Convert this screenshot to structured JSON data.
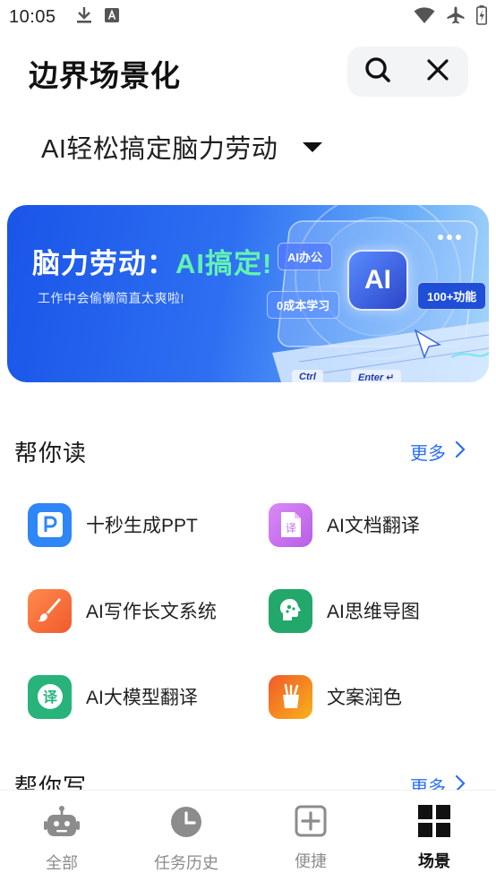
{
  "status_bar": {
    "time": "10:05",
    "left_icons": [
      "download-icon",
      "keyboard-a-icon"
    ],
    "right_icons": [
      "wifi-icon",
      "airplane-icon",
      "battery-charging-icon"
    ]
  },
  "header": {
    "title": "边界场景化",
    "actions": [
      "search-icon",
      "close-icon"
    ]
  },
  "selector": {
    "label": "AI轻松搞定脑力劳动"
  },
  "banner": {
    "headline_prefix": "脑力劳动：",
    "headline_accent": "AI搞定!",
    "subtitle": "工作中会偷懒简直太爽啦!",
    "tags": [
      "AI办公",
      "0成本学习",
      "100+功能"
    ],
    "logo_text": "AI",
    "keys": [
      "Ctrl",
      "Enter ↵"
    ],
    "colors": {
      "accent": "#62f2b2",
      "primary": "#2e6ff2"
    }
  },
  "sections": [
    {
      "title": "帮你读",
      "more": "更多",
      "items": [
        {
          "label": "十秒生成PPT",
          "icon": "ppt-icon",
          "color": "#2f86f6"
        },
        {
          "label": "AI文档翻译",
          "icon": "doc-translate-icon",
          "color": "#cf6ff0"
        },
        {
          "label": "AI写作长文系统",
          "icon": "brush-icon",
          "color": "#f46f3f"
        },
        {
          "label": "AI思维导图",
          "icon": "mind-map-icon",
          "color": "#22a86a"
        },
        {
          "label": "AI大模型翻译",
          "icon": "translate-icon",
          "color": "#27b37a"
        },
        {
          "label": "文案润色",
          "icon": "brush-cup-icon",
          "color": "#f7a21a"
        }
      ]
    },
    {
      "title": "帮你写",
      "more": "更多"
    }
  ],
  "bottom_nav": {
    "items": [
      {
        "label": "全部",
        "icon": "robot-icon",
        "active": false
      },
      {
        "label": "任务历史",
        "icon": "clock-icon",
        "active": false
      },
      {
        "label": "便捷",
        "icon": "add-square-icon",
        "active": false
      },
      {
        "label": "场景",
        "icon": "grid-icon",
        "active": true
      }
    ]
  }
}
